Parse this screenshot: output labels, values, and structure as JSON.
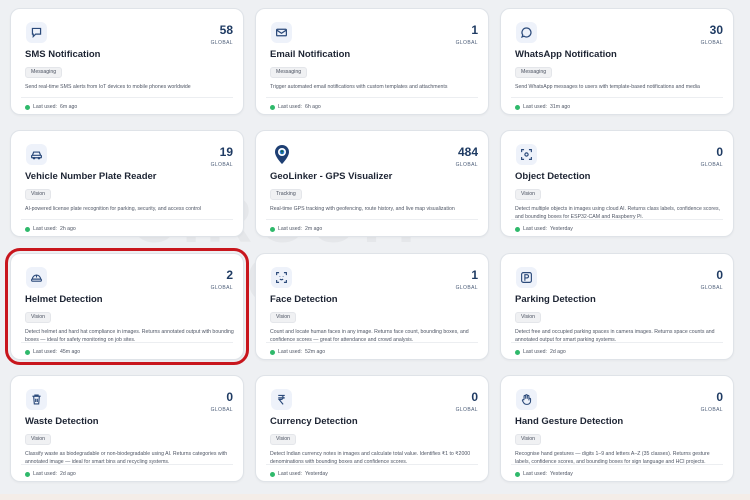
{
  "watermark": {
    "line1": "CIRCUIT",
    "line2": "DIGEST"
  },
  "scope_label": "GLOBAL",
  "last_used_prefix": "Last used:",
  "colors": {
    "accent": "#1f3b63",
    "status_dot": "#2fb96b",
    "selection": "#c8161d"
  },
  "cards": [
    {
      "icon": "chat-square-icon",
      "count": "58",
      "title": "SMS Notification",
      "tag": "Messaging",
      "desc": "Send real-time SMS alerts from IoT devices to mobile phones worldwide",
      "last_used": "6m ago",
      "selected": false
    },
    {
      "icon": "mail-icon",
      "count": "1",
      "title": "Email Notification",
      "tag": "Messaging",
      "desc": "Trigger automated email notifications with custom templates and attachments",
      "last_used": "6h ago",
      "selected": false
    },
    {
      "icon": "chat-bubble-icon",
      "count": "30",
      "title": "WhatsApp Notification",
      "tag": "Messaging",
      "desc": "Send WhatsApp messages to users with template-based notifications and media",
      "last_used": "31m ago",
      "selected": false
    },
    {
      "icon": "car-icon",
      "count": "19",
      "title": "Vehicle Number Plate Reader",
      "tag": "Vision",
      "desc": "AI-powered license plate recognition for parking, security, and access control",
      "last_used": "2h ago",
      "selected": false
    },
    {
      "icon": "map-pin-icon",
      "count": "484",
      "title": "GeoLinker - GPS Visualizer",
      "tag": "Tracking",
      "desc": "Real-time GPS tracking with geofencing, route history, and live map visualization",
      "last_used": "2m ago",
      "selected": false
    },
    {
      "icon": "object-scan-icon",
      "count": "0",
      "title": "Object Detection",
      "tag": "Vision",
      "desc": "Detect multiple objects in images using cloud AI. Returns class labels, confidence scores, and bounding boxes for ESP32-CAM and Raspberry Pi.",
      "last_used": "Yesterday",
      "selected": false
    },
    {
      "icon": "helmet-icon",
      "count": "2",
      "title": "Helmet Detection",
      "tag": "Vision",
      "desc": "Detect helmet and hard hat compliance in images. Returns annotated output with bounding boxes — ideal for safety monitoring on job sites.",
      "last_used": "45m ago",
      "selected": true
    },
    {
      "icon": "face-scan-icon",
      "count": "1",
      "title": "Face Detection",
      "tag": "Vision",
      "desc": "Count and locate human faces in any image. Returns face count, bounding boxes, and confidence scores — great for attendance and crowd analysis.",
      "last_used": "52m ago",
      "selected": false
    },
    {
      "icon": "parking-icon",
      "count": "0",
      "title": "Parking Detection",
      "tag": "Vision",
      "desc": "Detect free and occupied parking spaces in camera images. Returns space counts and annotated output for smart parking systems.",
      "last_used": "2d ago",
      "selected": false
    },
    {
      "icon": "trash-icon",
      "count": "0",
      "title": "Waste Detection",
      "tag": "Vision",
      "desc": "Classify waste as biodegradable or non-biodegradable using AI. Returns categories with annotated image — ideal for smart bins and recycling systems.",
      "last_used": "2d ago",
      "selected": false
    },
    {
      "icon": "rupee-icon",
      "count": "0",
      "title": "Currency Detection",
      "tag": "Vision",
      "desc": "Detect Indian currency notes in images and calculate total value. Identifies ₹1 to ₹2000 denominations with bounding boxes and confidence scores.",
      "last_used": "Yesterday",
      "selected": false
    },
    {
      "icon": "hand-icon",
      "count": "0",
      "title": "Hand Gesture Detection",
      "tag": "Vision",
      "desc": "Recognise hand gestures — digits 1–9 and letters A–Z (35 classes). Returns gesture labels, confidence scores, and bounding boxes for sign language and HCI projects.",
      "last_used": "Yesterday",
      "selected": false
    }
  ]
}
